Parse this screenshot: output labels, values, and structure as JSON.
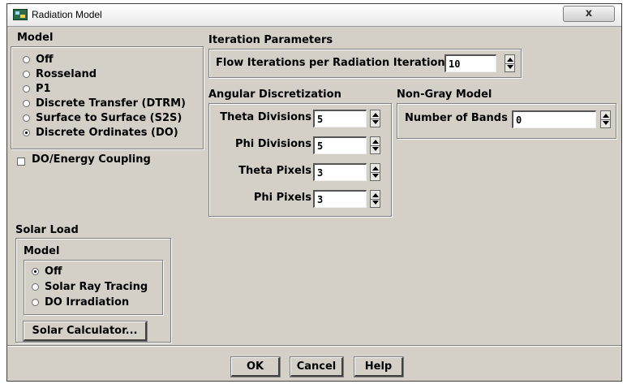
{
  "window": {
    "title": "Radiation Model",
    "close_label": "x"
  },
  "model": {
    "title": "Model",
    "options": [
      {
        "label": "Off",
        "selected": false
      },
      {
        "label": "Rosseland",
        "selected": false
      },
      {
        "label": "P1",
        "selected": false
      },
      {
        "label": "Discrete Transfer (DTRM)",
        "selected": false
      },
      {
        "label": "Surface to Surface (S2S)",
        "selected": false
      },
      {
        "label": "Discrete Ordinates (DO)",
        "selected": true
      }
    ]
  },
  "do_energy_coupling": {
    "label": "DO/Energy Coupling",
    "checked": false
  },
  "iteration_parameters": {
    "title": "Iteration Parameters",
    "flow_iterations_label": "Flow Iterations per Radiation Iteration",
    "flow_iterations_value": "10"
  },
  "angular_discretization": {
    "title": "Angular Discretization",
    "fields": [
      {
        "label": "Theta Divisions",
        "value": "5"
      },
      {
        "label": "Phi Divisions",
        "value": "5"
      },
      {
        "label": "Theta Pixels",
        "value": "3"
      },
      {
        "label": "Phi Pixels",
        "value": "3"
      }
    ]
  },
  "non_gray_model": {
    "title": "Non-Gray Model",
    "bands_label": "Number of Bands",
    "bands_value": "0"
  },
  "solar_load": {
    "title": "Solar Load",
    "model_title": "Model",
    "options": [
      {
        "label": "Off",
        "selected": true
      },
      {
        "label": "Solar Ray Tracing",
        "selected": false
      },
      {
        "label": "DO Irradiation",
        "selected": false
      }
    ],
    "calculator_label": "Solar Calculator..."
  },
  "buttons": {
    "ok": "OK",
    "cancel": "Cancel",
    "help": "Help"
  }
}
